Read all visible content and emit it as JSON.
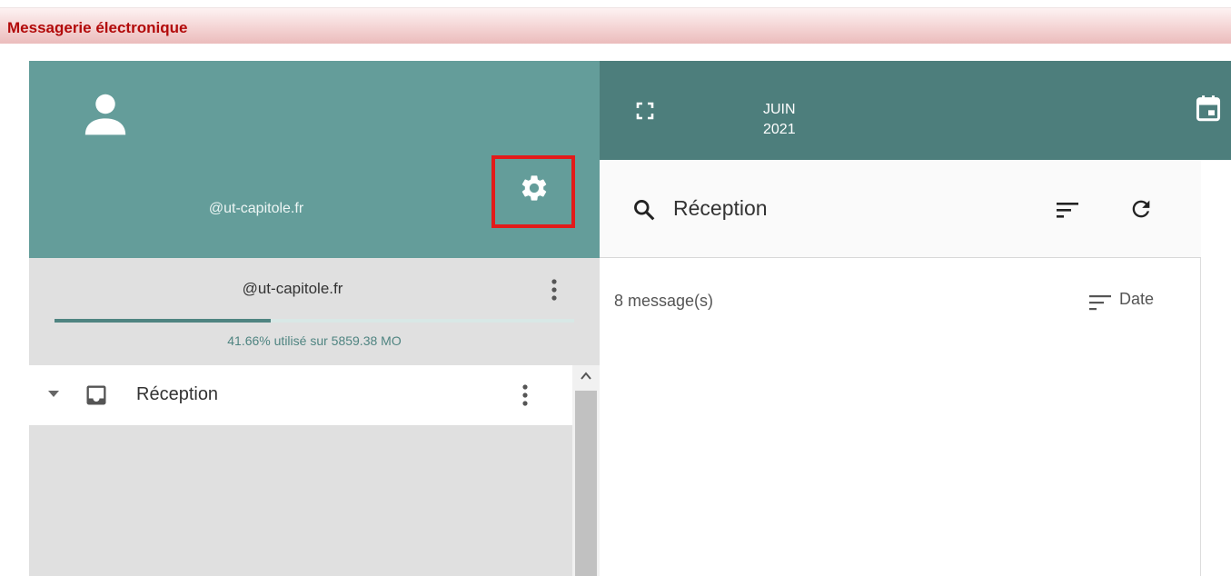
{
  "window": {
    "title": "Messagerie électronique"
  },
  "account": {
    "email": "@ut-capitole.fr",
    "icons": {
      "avatar": "person-icon",
      "settings": "gear-icon"
    },
    "highlight_color": "#e31a1a"
  },
  "storage": {
    "email": "@ut-capitole.fr",
    "used_percent": 41.66,
    "usage_text": "41.66% utilisé sur 5859.38 MO"
  },
  "folders": [
    {
      "label": "Réception",
      "icon": "inbox-icon",
      "expanded": true
    }
  ],
  "calendar": {
    "month": "JUIN",
    "year": "2021"
  },
  "message_list": {
    "folder_title": "Réception",
    "count_text": "8 message(s)",
    "sort_label": "Date"
  },
  "colors": {
    "header_teal": "#649d9a",
    "calendar_teal": "#4d7e7c",
    "title_red": "#b20a0a"
  }
}
